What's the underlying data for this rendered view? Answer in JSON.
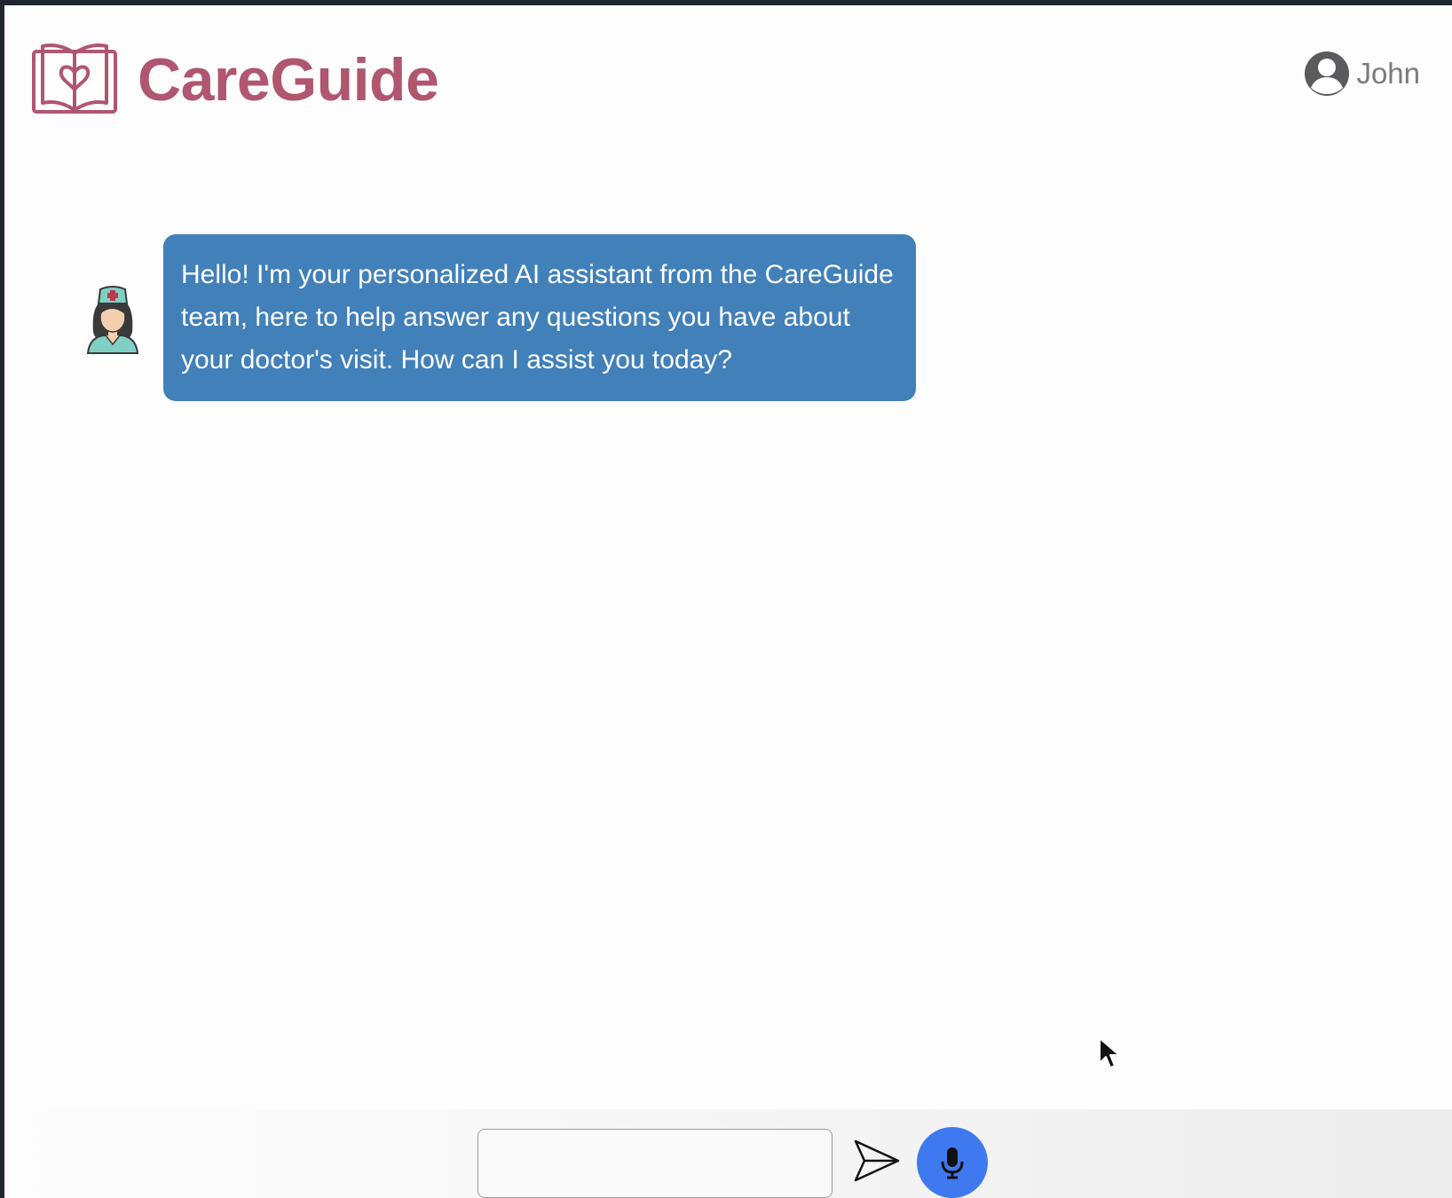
{
  "brand": {
    "name": "CareGuide",
    "color": "#b0566f"
  },
  "user": {
    "name": "John",
    "icon": "user-circle-icon"
  },
  "chat": {
    "messages": [
      {
        "sender": "assistant",
        "avatar": "nurse-avatar",
        "text": "Hello! I'm your personalized AI assistant from the CareGuide team, here to help answer any questions you have about your doctor's visit. How can I assist you today?"
      }
    ],
    "bubble_color": "#4280b9"
  },
  "composer": {
    "input_value": "",
    "placeholder": "",
    "send_icon": "send-icon",
    "mic_icon": "microphone-icon",
    "mic_color": "#3e79ef"
  }
}
